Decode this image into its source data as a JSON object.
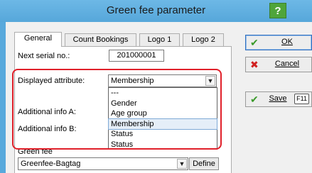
{
  "window": {
    "title": "Green fee parameter",
    "help_label": "?"
  },
  "tabs": [
    {
      "label": "General",
      "active": true
    },
    {
      "label": "Count Bookings",
      "active": false
    },
    {
      "label": "Logo 1",
      "active": false
    },
    {
      "label": "Logo 2",
      "active": false
    }
  ],
  "general": {
    "next_serial_label": "Next serial no.:",
    "next_serial_value": "201000001",
    "displayed_attribute_label": "Displayed attribute:",
    "displayed_attribute_value": "Membership",
    "additional_a_label": "Additional info A:",
    "additional_b_label": "Additional info B:",
    "greenfee_label": "Green fee",
    "greenfee_value": "Greenfee-Bagtag",
    "define_label": "Define"
  },
  "dropdown": {
    "options": [
      "---",
      "Gender",
      "Age group",
      "Membership",
      "Status",
      "Status"
    ],
    "selected_index": 3
  },
  "buttons": {
    "ok": {
      "label": "OK",
      "icon": "check-icon"
    },
    "cancel": {
      "label": "Cancel",
      "icon": "x-icon"
    },
    "save": {
      "label": "Save",
      "icon": "check-icon",
      "shortcut": "F11"
    }
  },
  "colors": {
    "titlebar": "#58a9dc",
    "highlight": "#e0202a",
    "help": "#4fa53a",
    "check": "#3a9a2a",
    "cross": "#d02020"
  }
}
